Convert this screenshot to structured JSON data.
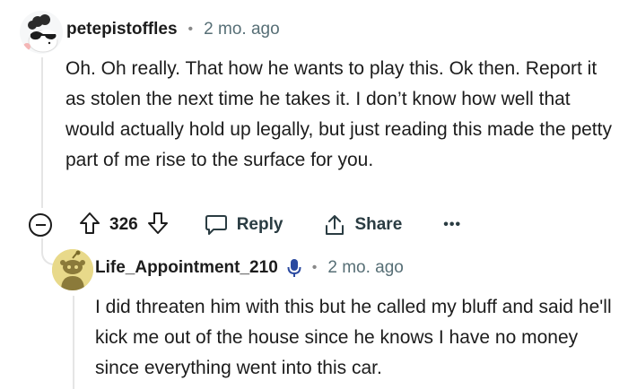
{
  "comment": {
    "username": "petepistoffles",
    "time": "2 mo. ago",
    "body": "Oh. Oh really. That how he wants to play this. Ok then. Report it as stolen the next time he takes it. I don’t know how well that would actually hold up legally, but just reading this made the petty part of me rise to the surface for you.",
    "score": "326",
    "actions": {
      "reply_label": "Reply",
      "share_label": "Share",
      "more_label": "•••"
    },
    "separator": "•"
  },
  "reply": {
    "username": "Life_Appointment_210",
    "time": "2 mo. ago",
    "body": "I did threaten him with this but he called my bluff and said he'll kick me out of the house since he knows I have no money since everything went into this car.",
    "separator": "•"
  },
  "colors": {
    "text": "#1c1c1c",
    "meta": "#576f76",
    "thread_line": "#e5e5e5",
    "mic_icon": "#2b4aa0",
    "avatar2_bg": "#e8d98a"
  }
}
